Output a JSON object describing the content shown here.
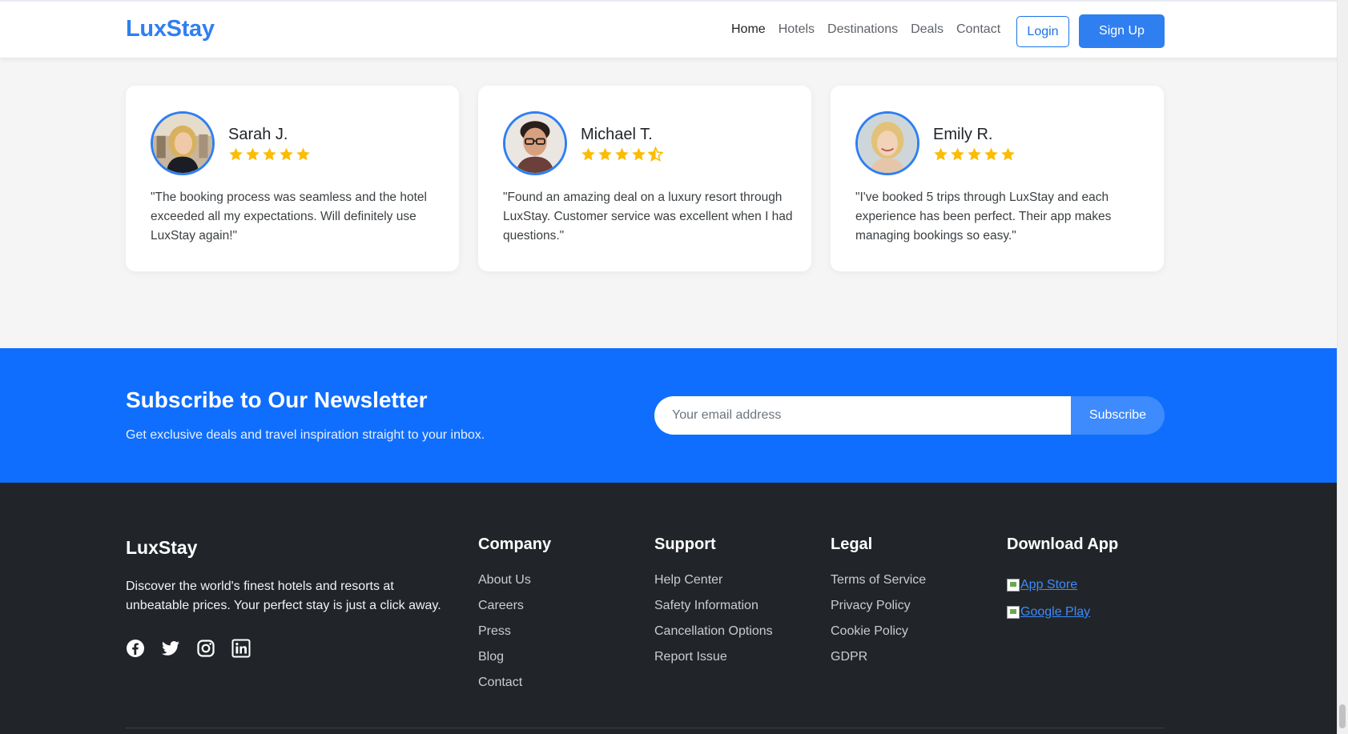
{
  "nav": {
    "brand": "LuxStay",
    "links": [
      "Home",
      "Hotels",
      "Destinations",
      "Deals",
      "Contact"
    ],
    "login": "Login",
    "signup": "Sign Up"
  },
  "testimonials": [
    {
      "name": "Sarah J.",
      "rating": 5,
      "quote": "\"The booking process was seamless and the hotel exceeded all my expectations. Will definitely use LuxStay again!\""
    },
    {
      "name": "Michael T.",
      "rating": 4.5,
      "quote": "\"Found an amazing deal on a luxury resort through LuxStay. Customer service was excellent when I had questions.\""
    },
    {
      "name": "Emily R.",
      "rating": 5,
      "quote": "\"I've booked 5 trips through LuxStay and each experience has been perfect. Their app makes managing bookings so easy.\""
    }
  ],
  "newsletter": {
    "title": "Subscribe to Our Newsletter",
    "subtitle": "Get exclusive deals and travel inspiration straight to your inbox.",
    "placeholder": "Your email address",
    "button": "Subscribe"
  },
  "footer": {
    "brand": "LuxStay",
    "description": "Discover the world's finest hotels and resorts at unbeatable prices. Your perfect stay is just a click away.",
    "socials": [
      "facebook-icon",
      "twitter-icon",
      "instagram-icon",
      "linkedin-icon"
    ],
    "company": {
      "title": "Company",
      "links": [
        "About Us",
        "Careers",
        "Press",
        "Blog",
        "Contact"
      ]
    },
    "support": {
      "title": "Support",
      "links": [
        "Help Center",
        "Safety Information",
        "Cancellation Options",
        "Report Issue"
      ]
    },
    "legal": {
      "title": "Legal",
      "links": [
        "Terms of Service",
        "Privacy Policy",
        "Cookie Policy",
        "GDPR"
      ]
    },
    "app": {
      "title": "Download App",
      "links": [
        "App Store",
        "Google Play"
      ]
    }
  },
  "colors": {
    "brand": "#2f7ff0",
    "newsletter_bg": "#0f6efd",
    "footer_bg": "#212529",
    "star": "#fbbc04"
  }
}
